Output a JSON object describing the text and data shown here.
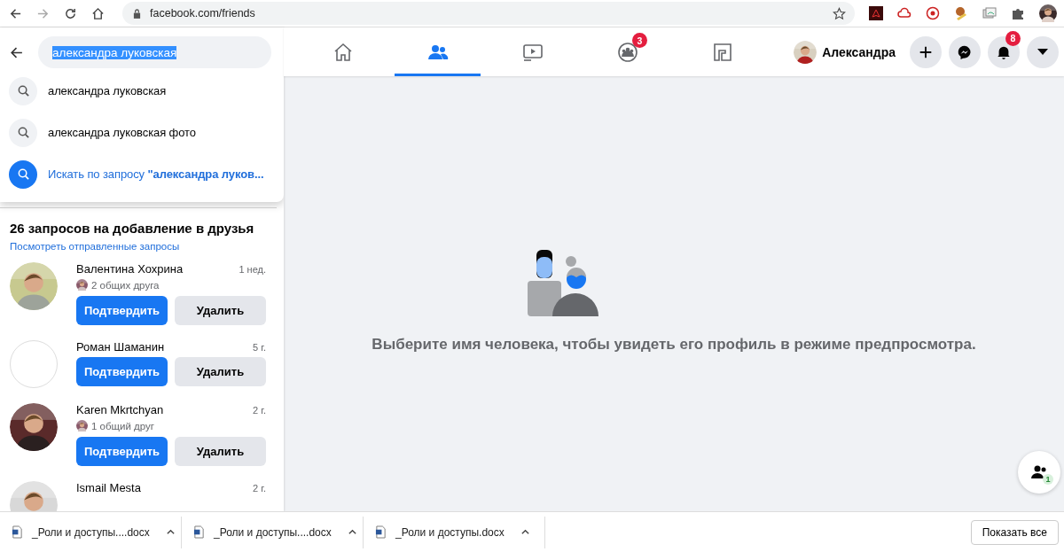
{
  "browser": {
    "url": "facebook.com/friends"
  },
  "search": {
    "value": "александра луковская",
    "suggestions": [
      {
        "kind": "history",
        "text": "александра луковская"
      },
      {
        "kind": "history",
        "text": "александра луковская фото"
      },
      {
        "kind": "query",
        "text": "Искать по запросу **\"александра луков...**"
      }
    ]
  },
  "nav": {
    "tabs": [
      {
        "kind": "home",
        "selected": false
      },
      {
        "kind": "friends",
        "selected": true
      },
      {
        "kind": "watch",
        "selected": false
      },
      {
        "kind": "groups",
        "selected": false,
        "badge": "3"
      },
      {
        "kind": "gaming",
        "selected": false
      }
    ]
  },
  "profile": {
    "name": "Александра"
  },
  "actions": [
    {
      "kind": "plus"
    },
    {
      "kind": "messenger"
    },
    {
      "kind": "bell",
      "badge": "8"
    },
    {
      "kind": "caret"
    }
  ],
  "requests": {
    "title": "26 запросов на добавление в друзья",
    "link": "Посмотреть отправленные запросы",
    "items": [
      {
        "name": "Валентина Хохрина",
        "time": "1 нед.",
        "has_photo": true,
        "mutual": "2 общих друга",
        "confirm": "Подтвердить",
        "delete": "Удалить"
      },
      {
        "name": "Роман Шаманин",
        "time": "5 г.",
        "has_photo": false,
        "confirm": "Подтвердить",
        "delete": "Удалить"
      },
      {
        "name": "Karen Mkrtchyan",
        "time": "2 г.",
        "has_photo": true,
        "mutual": "1 общий друг",
        "confirm": "Подтвердить",
        "delete": "Удалить"
      },
      {
        "name": "Ismail Mesta",
        "time": "2 г.",
        "has_photo": true
      }
    ]
  },
  "empty_state": {
    "message": "Выберите имя человека, чтобы увидеть его профиль в режиме предпросмотра."
  },
  "contacts_button": {
    "badge": "1"
  },
  "downloads": {
    "files": [
      "_Роли и доступы....docx",
      "_Роли и доступы....docx",
      "_Роли и доступы.docx"
    ],
    "show_all": "Показать все"
  }
}
